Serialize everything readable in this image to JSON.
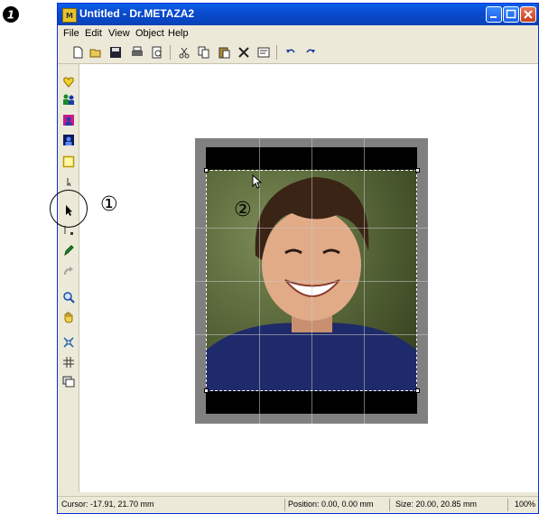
{
  "step_number": "1",
  "window": {
    "title": "Untitled - Dr.METAZA2",
    "app_icon_text": "M"
  },
  "menu": [
    "File",
    "Edit",
    "View",
    "Object",
    "Help"
  ],
  "toolbar": {
    "icons": [
      "new-icon",
      "open-icon",
      "save-icon",
      "print-icon",
      "print-preview-icon",
      "cut-icon",
      "copy-icon",
      "paste-icon",
      "delete-icon",
      "properties-icon",
      "undo-icon",
      "redo-icon"
    ]
  },
  "left_tools": [
    "heart-icon",
    "people-icon",
    "portrait-icon",
    "portrait-dark-icon",
    "rectangle-icon",
    "pointer-small-icon",
    "select-arrow-icon",
    "node-edit-icon",
    "pen-icon",
    "rotate-icon",
    "zoom-icon",
    "hand-icon",
    "fit-icon",
    "grid-icon",
    "layer-icon"
  ],
  "status": {
    "cursor": "Cursor: -17.91, 21.70 mm",
    "position": "Position: 0.00, 0.00 mm",
    "size": "Size: 20.00, 20.85 mm",
    "zoom": "100%"
  },
  "callouts": {
    "one": "①",
    "two": "②"
  }
}
